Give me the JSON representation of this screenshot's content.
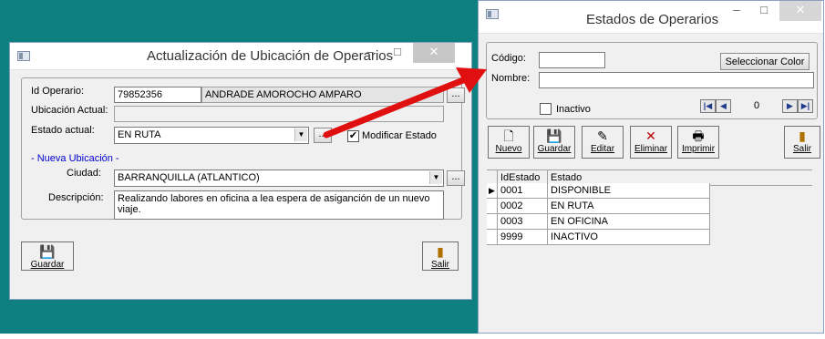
{
  "left_window": {
    "title": "Actualización de Ubicación de Operarios",
    "controls": {
      "minimize": "–",
      "maximize": "□",
      "close": "✕"
    },
    "labels": {
      "id_operario": "Id Operario:",
      "ubicacion_actual": "Ubicación Actual:",
      "estado_actual": "Estado actual:",
      "nueva_ubicacion": "- Nueva Ubicación -",
      "ciudad": "Ciudad:",
      "descripcion": "Descripción:"
    },
    "values": {
      "id_operario": "79852356",
      "nombre_operario": "ANDRADE AMOROCHO AMPARO",
      "ubicacion_actual": "",
      "estado_actual": "EN RUTA",
      "ciudad": "BARRANQUILLA  (ATLANTICO)",
      "descripcion": "Realizando labores en oficina a lea espera de asiganción de un nuevo viaje."
    },
    "ellipsis": "...",
    "modificar_estado": {
      "label": "Modificar Estado",
      "checked": true
    },
    "buttons": {
      "guardar": "Guardar",
      "salir": "Salir"
    }
  },
  "right_window": {
    "title": "Estados de Operarios",
    "controls": {
      "minimize": "–",
      "maximize": "□",
      "close": "✕"
    },
    "labels": {
      "codigo": "Código:",
      "nombre": "Nombre:",
      "inactivo": "Inactivo"
    },
    "values": {
      "codigo": "",
      "nombre": ""
    },
    "inactivo_checked": false,
    "seleccionar_color": "Seleccionar Color",
    "navigator": {
      "first": "|◀",
      "prev": "◀",
      "position": "0",
      "next": "▶",
      "last": "▶|"
    },
    "toolbar": [
      {
        "name": "nuevo",
        "label": "Nuevo",
        "icon": "new-document-icon"
      },
      {
        "name": "guardar",
        "label": "Guardar",
        "icon": "floppy-disk-icon"
      },
      {
        "name": "editar",
        "label": "Editar",
        "icon": "edit-icon"
      },
      {
        "name": "eliminar",
        "label": "Eliminar",
        "icon": "delete-x-icon"
      },
      {
        "name": "imprimir",
        "label": "Imprimir",
        "icon": "printer-icon"
      }
    ],
    "salir": "Salir",
    "grid": {
      "columns": [
        "IdEstado",
        "Estado"
      ],
      "rows": [
        [
          "0001",
          "DISPONIBLE"
        ],
        [
          "0002",
          "EN RUTA"
        ],
        [
          "0003",
          "EN OFICINA"
        ],
        [
          "9999",
          "INACTIVO"
        ]
      ],
      "current_row": 0
    }
  },
  "colors": {
    "desktop": "#0f8080",
    "arrow": "#e01010",
    "link_label": "#0000cc"
  }
}
